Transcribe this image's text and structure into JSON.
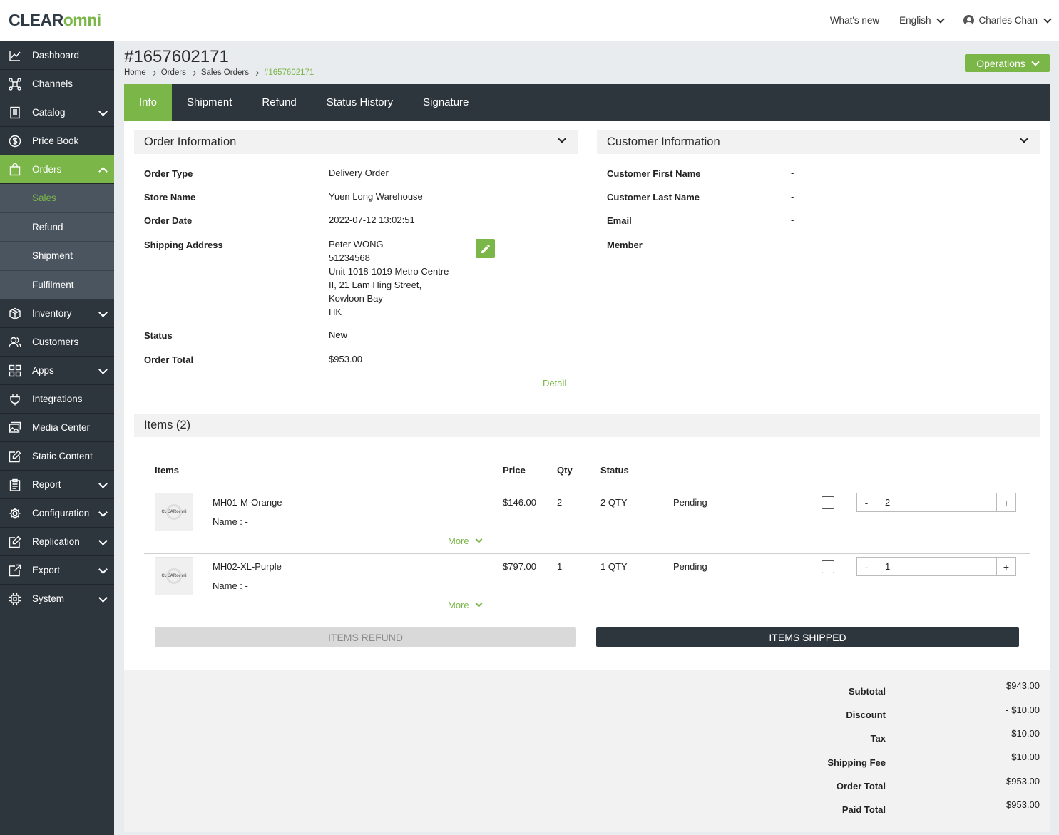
{
  "header": {
    "logo_clear": "CLEAR",
    "logo_omni": "omni",
    "whats_new": "What's new",
    "language": "English",
    "user_name": "Charles Chan"
  },
  "sidebar": {
    "items": [
      {
        "label": "Dashboard",
        "icon": "chart-line-icon"
      },
      {
        "label": "Channels",
        "icon": "network-icon"
      },
      {
        "label": "Catalog",
        "icon": "catalog-icon"
      },
      {
        "label": "Price Book",
        "icon": "dollar-circle-icon"
      },
      {
        "label": "Orders",
        "icon": "bag-icon"
      },
      {
        "label": "Inventory",
        "icon": "box-icon"
      },
      {
        "label": "Customers",
        "icon": "users-icon"
      },
      {
        "label": "Apps",
        "icon": "grid-icon"
      },
      {
        "label": "Integrations",
        "icon": "plug-icon"
      },
      {
        "label": "Media Center",
        "icon": "images-icon"
      },
      {
        "label": "Static Content",
        "icon": "edit-doc-icon"
      },
      {
        "label": "Report",
        "icon": "clipboard-icon"
      },
      {
        "label": "Configuration",
        "icon": "gear-icon"
      },
      {
        "label": "Replication",
        "icon": "edit-doc-icon"
      },
      {
        "label": "Export",
        "icon": "export-icon"
      },
      {
        "label": "System",
        "icon": "chip-icon"
      }
    ],
    "orders_sub": [
      "Sales",
      "Refund",
      "Shipment",
      "Fulfilment"
    ]
  },
  "page": {
    "title": "#1657602171",
    "breadcrumb": [
      "Home",
      "Orders",
      "Sales Orders",
      "#1657602171"
    ],
    "operations_label": "Operations"
  },
  "tabs": [
    "Info",
    "Shipment",
    "Refund",
    "Status History",
    "Signature"
  ],
  "order_info": {
    "heading": "Order Information",
    "labels": {
      "order_type": "Order Type",
      "store_name": "Store Name",
      "order_date": "Order Date",
      "shipping_address": "Shipping Address",
      "status": "Status",
      "order_total": "Order Total"
    },
    "values": {
      "order_type": "Delivery Order",
      "store_name": "Yuen Long Warehouse",
      "order_date": "2022-07-12 13:02:51",
      "address_lines": [
        "Peter WONG",
        "51234568",
        "Unit 1018-1019 Metro Centre",
        "II, 21 Lam Hing Street,",
        "Kowloon Bay",
        "HK"
      ],
      "status": "New",
      "order_total": "$953.00"
    },
    "detail_link": "Detail"
  },
  "customer_info": {
    "heading": "Customer Information",
    "labels": {
      "first_name": "Customer First Name",
      "last_name": "Customer Last Name",
      "email": "Email",
      "member": "Member"
    },
    "values": {
      "first_name": "-",
      "last_name": "-",
      "email": "-",
      "member": "-"
    }
  },
  "items": {
    "heading": "Items (2)",
    "columns": {
      "items": "Items",
      "price": "Price",
      "qty": "Qty",
      "status": "Status"
    },
    "thumb_text": "CLEARomni",
    "more_label": "More",
    "rows": [
      {
        "sku": "MH01-M-Orange",
        "name": "Name : -",
        "price": "$146.00",
        "qty": "2",
        "status_qty": "2 QTY",
        "status": "Pending",
        "input_value": "2"
      },
      {
        "sku": "MH02-XL-Purple",
        "name": "Name : -",
        "price": "$797.00",
        "qty": "1",
        "status_qty": "1 QTY",
        "status": "Pending",
        "input_value": "1"
      }
    ],
    "minus_label": "-",
    "plus_label": "+",
    "refund_button": "ITEMS REFUND",
    "shipped_button": "ITEMS SHIPPED"
  },
  "totals": {
    "subtotal_label": "Subtotal",
    "subtotal": "$943.00",
    "discount_label": "Discount",
    "discount": "- $10.00",
    "tax_label": "Tax",
    "tax": "$10.00",
    "shipping_label": "Shipping Fee",
    "shipping": "$10.00",
    "order_total_label": "Order Total",
    "order_total": "$953.00",
    "paid_total_label": "Paid Total",
    "paid_total": "$953.00"
  },
  "colors": {
    "accent": "#7ab648",
    "dark": "#2d353d"
  }
}
